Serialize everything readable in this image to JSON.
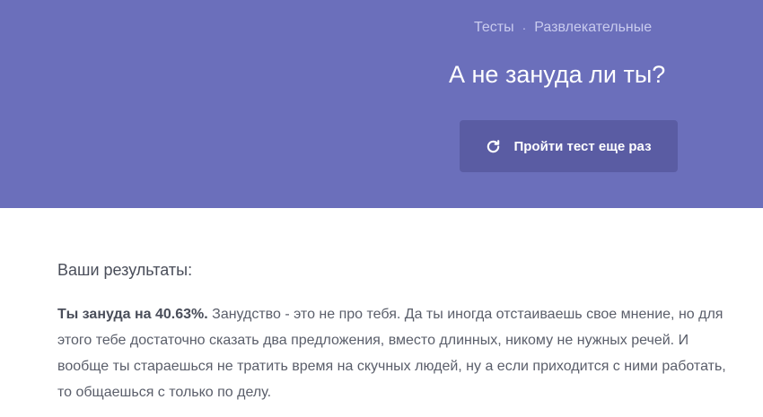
{
  "breadcrumb": {
    "items": [
      "Тесты",
      "Развлекательные"
    ],
    "separator": "·"
  },
  "header": {
    "title": "А не зануда ли ты?",
    "retry_label": "Пройти тест еще раз",
    "retry_icon": "refresh-icon"
  },
  "results": {
    "heading": "Ваши результаты:",
    "score_text": "Ты зануда на 40.63%.",
    "description": " Занудство - это не про тебя. Да ты иногда отстаиваешь свое мнение, но для этого тебе достаточно сказать два предложения, вместо длинных, никому не нужных речей. И вообще ты стараешься не тратить время на скучных людей, ну а если приходится с ними работать, то общаешься с только по делу."
  },
  "colors": {
    "hero_background": "#6b6fbb",
    "button_background": "#5a5ca3",
    "text": "#5a5e6a"
  }
}
